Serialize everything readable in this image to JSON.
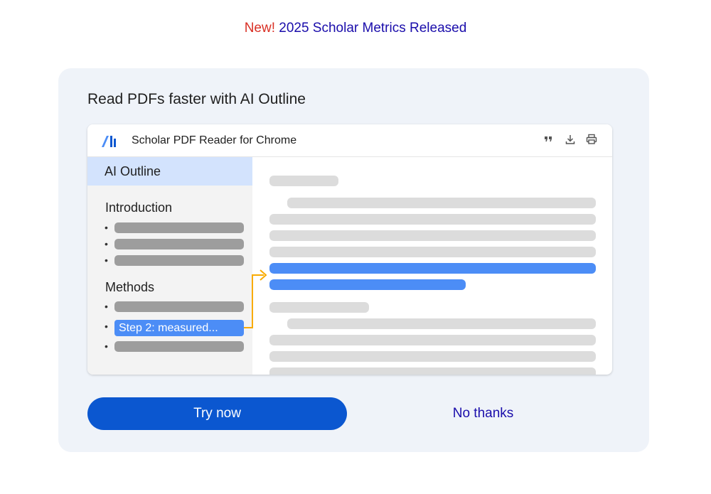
{
  "announcement": {
    "new_label": "New!",
    "text": "2025 Scholar Metrics Released"
  },
  "promo": {
    "title": "Read PDFs faster with AI Outline",
    "window": {
      "name": "Scholar PDF Reader for Chrome",
      "icons": [
        "quote-icon",
        "download-icon",
        "print-icon"
      ]
    },
    "outline": {
      "header": "AI Outline",
      "sections": [
        {
          "title": "Introduction"
        },
        {
          "title": "Methods",
          "highlighted_item": "Step 2: measured..."
        }
      ],
      "bullet": "•"
    },
    "actions": {
      "primary": "Try now",
      "secondary": "No thanks"
    }
  },
  "colors": {
    "accent": "#0b57d0",
    "new_red": "#d93025",
    "link": "#1a0dab",
    "highlight": "#4c8df6",
    "connector": "#f9ab00"
  }
}
